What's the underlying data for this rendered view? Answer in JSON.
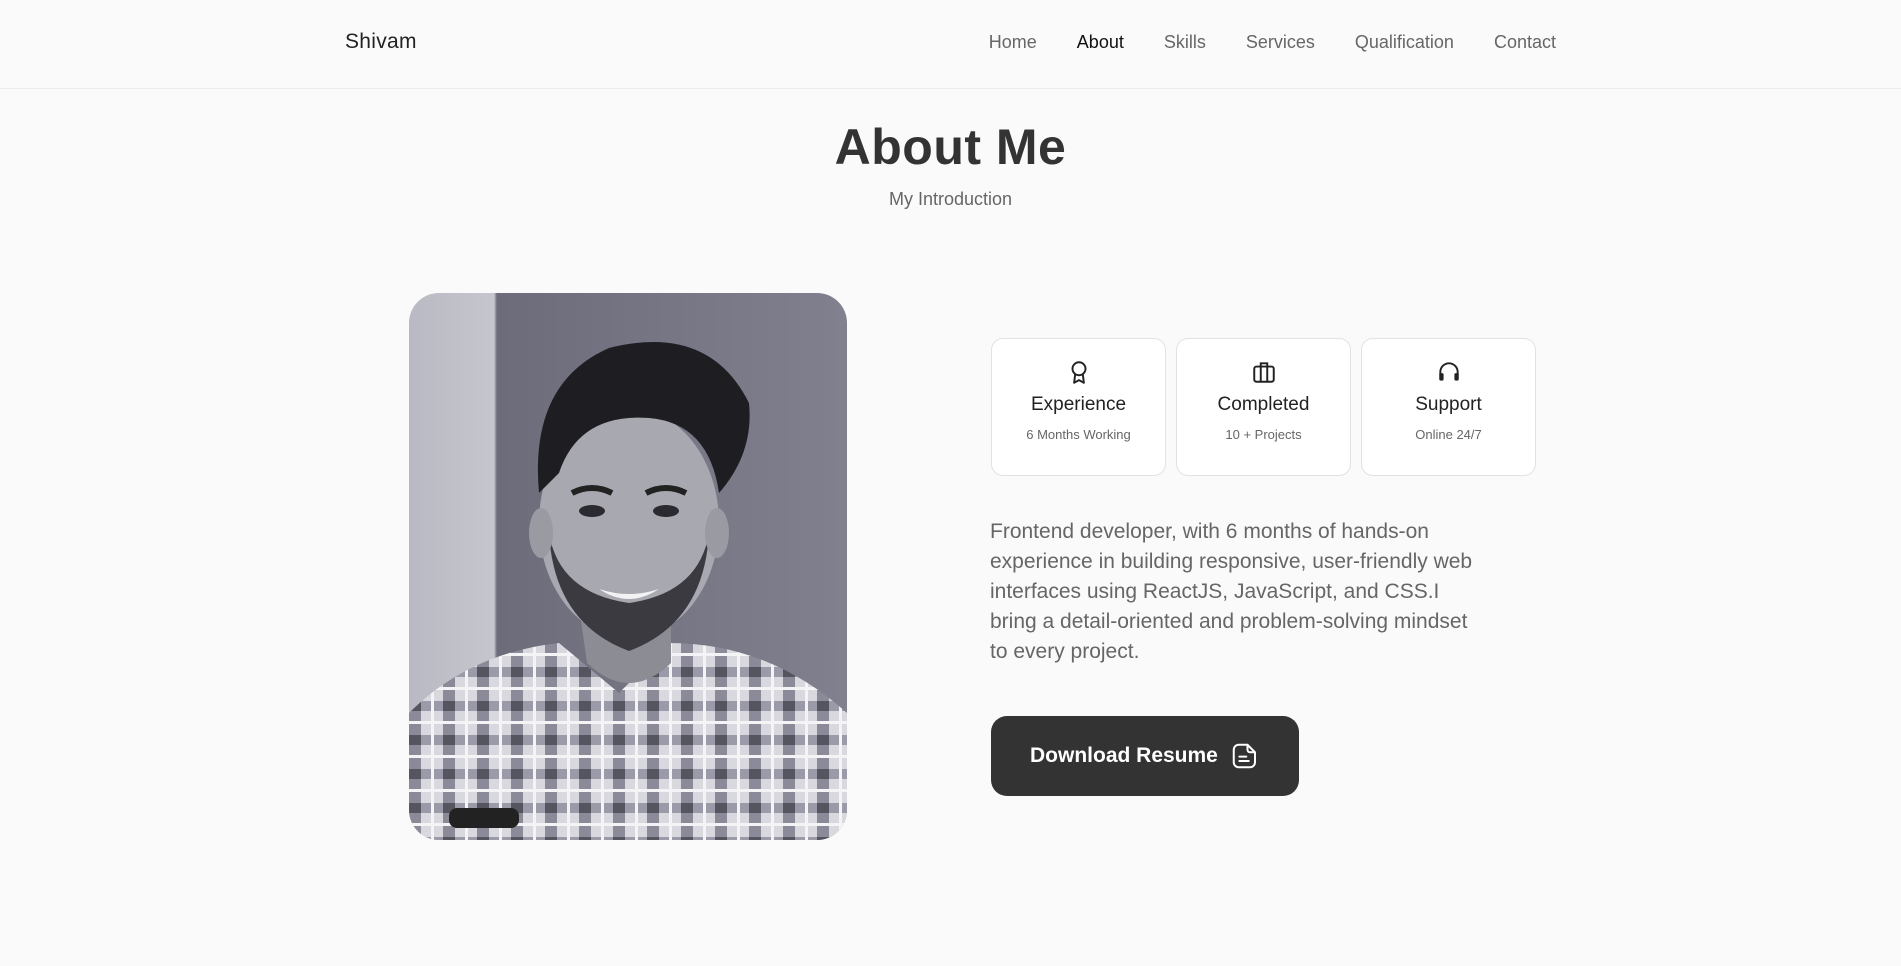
{
  "header": {
    "logo": "Shivam",
    "nav": [
      {
        "label": "Home"
      },
      {
        "label": "About",
        "active": true
      },
      {
        "label": "Skills"
      },
      {
        "label": "Services"
      },
      {
        "label": "Qualification"
      },
      {
        "label": "Contact"
      }
    ]
  },
  "section": {
    "title": "About Me",
    "subtitle": "My Introduction"
  },
  "photo": {
    "icon": "profile-photo"
  },
  "cards": [
    {
      "icon": "award-icon",
      "title": "Experience",
      "subtitle": "6 Months Working"
    },
    {
      "icon": "briefcase-icon",
      "title": "Completed",
      "subtitle": "10 + Projects"
    },
    {
      "icon": "headset-icon",
      "title": "Support",
      "subtitle": "Online 24/7"
    }
  ],
  "description": "Frontend developer, with 6 months of hands-on experience in building responsive, user-friendly web interfaces using ReactJS, JavaScript, and CSS.I bring a detail-oriented and problem-solving mindset to every project.",
  "button": {
    "label": "Download Resume",
    "icon": "document-icon"
  },
  "colors": {
    "background": "#fafafa",
    "text": "#333333",
    "muted": "#666666",
    "button": "#333333"
  }
}
